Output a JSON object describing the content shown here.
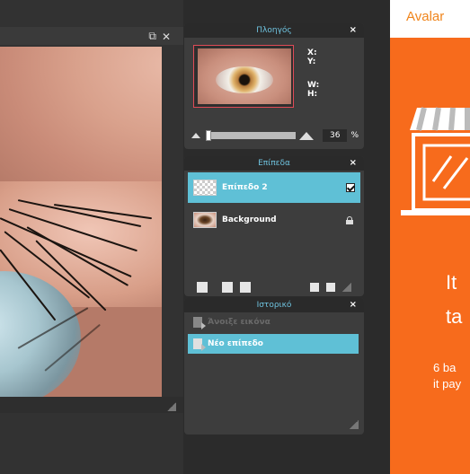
{
  "doc_window": {
    "restore_icon": "⧉",
    "close_icon": "✕"
  },
  "navigator": {
    "title": "Πλοηγός",
    "close": "×",
    "x_label": "X:",
    "y_label": "Y:",
    "w_label": "W:",
    "h_label": "H:",
    "zoom_value": "36",
    "zoom_unit": "%"
  },
  "layers": {
    "title": "Επίπεδα",
    "close": "×",
    "items": [
      {
        "name": "Επίπεδο 2",
        "selected": true,
        "visible": true
      },
      {
        "name": "Background",
        "selected": false,
        "locked": true
      }
    ]
  },
  "history": {
    "title": "Ιστορικό",
    "close": "×",
    "items": [
      {
        "label": "Άνοιξε εικόνα",
        "active": false
      },
      {
        "label": "Νέο επίπεδο",
        "active": true
      }
    ]
  },
  "ad": {
    "logo": "Avalar",
    "headline_line1": "It",
    "headline_line2": "ta",
    "sub_line1": "6 ba",
    "sub_line2": "it pay",
    "bg_color": "#f76b1c"
  }
}
